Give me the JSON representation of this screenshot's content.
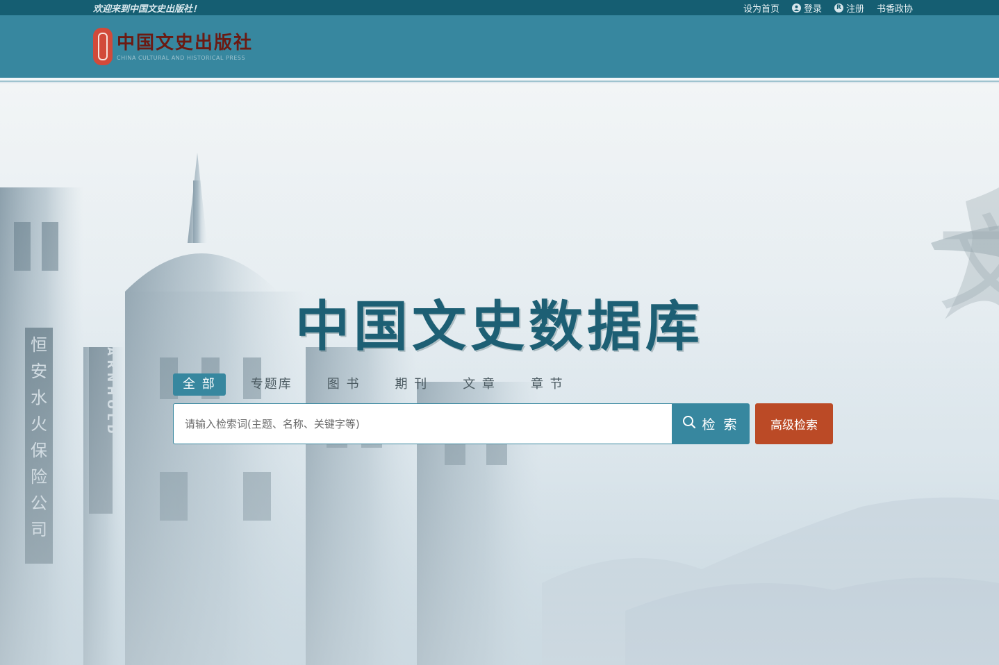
{
  "topbar": {
    "welcome": "欢迎来到中国文史出版社！",
    "links": {
      "homepage": "设为首页",
      "login": "登录",
      "register": "注册",
      "shuxiang": "书香政协"
    },
    "icons": {
      "login": "user-icon",
      "register": "registered-icon"
    }
  },
  "header": {
    "logo_cn": "中国文史出版社",
    "logo_en": "CHINA CULTURAL AND HISTORICAL PRESS"
  },
  "hero": {
    "title": "中国文史数据库",
    "tabs": [
      {
        "label": "全 部",
        "active": true
      },
      {
        "label": "专题库",
        "active": false
      },
      {
        "label": "图 书",
        "active": false
      },
      {
        "label": "期 刊",
        "active": false
      },
      {
        "label": "文 章",
        "active": false
      },
      {
        "label": "章 节",
        "active": false
      }
    ],
    "search": {
      "placeholder": "请输入检索词(主题、名称、关键字等)",
      "value": "",
      "button": "检 索",
      "advanced": "高级检索"
    },
    "background_text": [
      "恒",
      "安",
      "水",
      "火",
      "保",
      "险",
      "公",
      "司",
      "ARNHOLD",
      "文"
    ]
  },
  "colors": {
    "topbar": "#155e72",
    "header": "#37879f",
    "accent": "#37879f",
    "advanced_button": "#bb4a26",
    "title": "#1d5f74",
    "seal": "#d24a3a"
  }
}
